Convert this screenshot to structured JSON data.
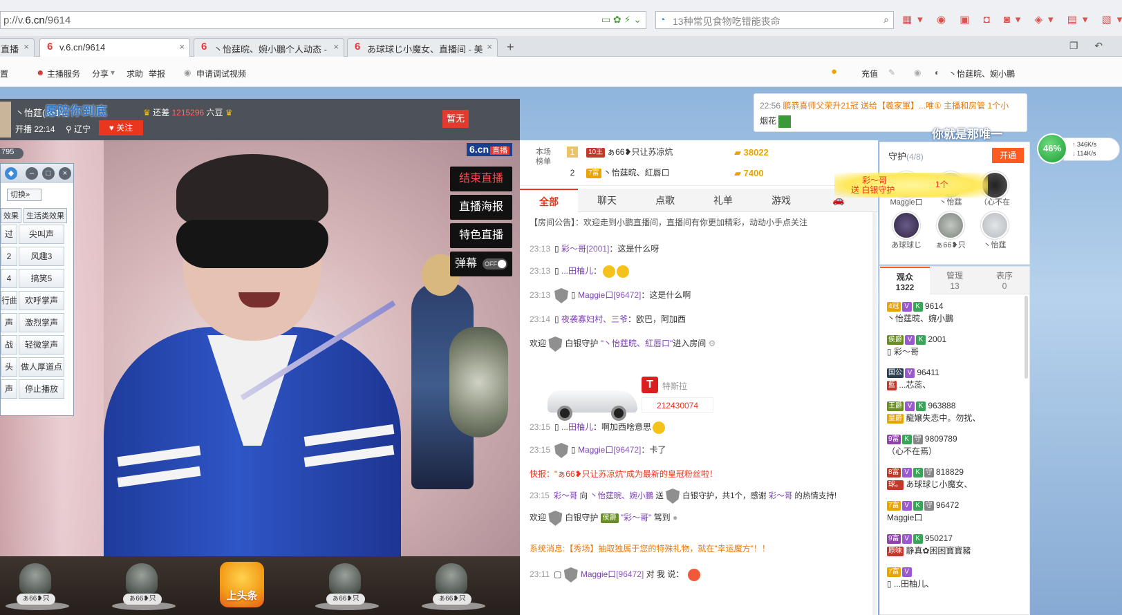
{
  "browser": {
    "url_prefix": "p://v.",
    "url_host": "6.cn",
    "url_path": "/9614",
    "search_placeholder": "13种常见食物吃错能丧命",
    "tabs": [
      {
        "label": "直播",
        "active": false
      },
      {
        "label": "v.6.cn/9614",
        "active": true
      },
      {
        "label": "丶怡莛晥、婉小鵬个人动态 -",
        "active": false
      },
      {
        "label": "あ球球じ小魔女、直播间 - 美",
        "active": false
      }
    ]
  },
  "site_nav": {
    "left": [
      "置",
      "主播服务",
      "分享",
      "求助",
      "举报",
      "申请调试视频"
    ],
    "recharge": "充值",
    "username": "丶怡莛晥、婉小鵬"
  },
  "anchor": {
    "name": "丶怡莛",
    "name_suffix": "614）",
    "overlay_text": "愿陪你到底",
    "rank_prefix": "还差",
    "rank_num": "1215296",
    "rank_suffix": "六豆",
    "start_time": "开播 22:14",
    "location": "辽宁",
    "follow_label": "关注",
    "flag_label": "暂无"
  },
  "video": {
    "logo": "6.cn",
    "logo_live": "直播",
    "buttons": [
      "结束直播",
      "直播海报",
      "特色直播"
    ],
    "danmu_label": "弹幕",
    "danmu_state": "OFF"
  },
  "effects_panel": {
    "count": "795",
    "switch_label": "切换»",
    "tabs": [
      "效果",
      "生活类效果"
    ],
    "cells_left": [
      "过",
      "2",
      "4",
      "行曲",
      "声",
      "战",
      "头",
      "声"
    ],
    "cells_right": [
      "尖叫声",
      "风趣3",
      "搞笑5",
      "欢呼掌声",
      "激烈掌声",
      "轻微掌声",
      "做人厚道点",
      "停止播放"
    ]
  },
  "gift_strip": {
    "items": [
      "ぁ66❥只",
      "ぁ66❥只",
      "ぁ66❥只",
      "ぁ66❥只"
    ],
    "hot_label": "上头条"
  },
  "rank_board": {
    "label": "本场榜单",
    "rows": [
      {
        "no": "1",
        "badge": "10王",
        "name": "ぁ66❥只让苏凉炕",
        "coins": "38022"
      },
      {
        "no": "2",
        "badge": "7富",
        "name": "丶怡莛晥、紅唇口",
        "coins": "7400"
      }
    ]
  },
  "chat": {
    "tabs": [
      "全部",
      "聊天",
      "点歌",
      "礼单",
      "游戏"
    ],
    "notice": "【房间公告】：欢迎走到小鹏直播间，直播间有你更加精彩，动动小手点关注",
    "messages": [
      {
        "time": "23:13",
        "user": "彩～哥",
        "num": "[2001]",
        "text": "：这是什么呀"
      },
      {
        "time": "23:13",
        "user": "...田柚儿",
        "num": "",
        "text": "："
      },
      {
        "time": "23:13",
        "user": "Maggie口",
        "num": "[96472]",
        "text": "：这是什么啊"
      },
      {
        "time": "23:14",
        "user": "夜袭寡妇村、三爷",
        "num": "",
        "text": "：欧巴，阿加西"
      },
      {
        "time": "23:15",
        "user": "...田柚儿",
        "num": "",
        "text": "：啊加西啥意思"
      },
      {
        "time": "23:15",
        "user": "Maggie口",
        "num": "[96472]",
        "text": "：卡了"
      },
      {
        "time": "23:11",
        "user": "Maggie口",
        "num": "[96472]",
        "text": "对 我 说："
      }
    ],
    "welcome_1_prefix": "欢迎",
    "welcome_1_role": "白银守护",
    "welcome_1_user": "\"丶怡莛晥、紅唇口\"",
    "welcome_1_suffix": "进入房间",
    "car_name": "特斯拉",
    "car_number": "212430074",
    "flash": "快报：\"ぁ66❥只让苏凉炕\"成为最新的皇冠粉丝啦！",
    "gift_time": "23:15",
    "gift_user": "彩～哥",
    "gift_to": "向",
    "gift_target": "丶怡莛晥、婉小鵬",
    "gift_text": "送",
    "gift_item": "白银守护，共1个，感谢",
    "gift_thanks_user": "彩～哥",
    "gift_end": "的热情支持!",
    "welcome_2_prefix": "欢迎",
    "welcome_2_role": "白银守护",
    "welcome_2_user": "\"彩～哥\"",
    "welcome_2_suffix": "驾到",
    "system": "系统消息:【秀场】抽取独属于您的特殊礼物，就在\"幸运魔方\"！！"
  },
  "top_notice": {
    "time": "22:56",
    "text": "鹏恭喜师父荣升21冠 送给【羲家軍】...唯① 主播和房管 1个小",
    "text2": "烟花"
  },
  "banner_text": "你就是那唯一",
  "speed": {
    "percent": "46%",
    "up": "346K/s",
    "down": "114K/s"
  },
  "guard": {
    "title": "守护",
    "count": "(4/8)",
    "open_label": "开通",
    "popup_user": "彩～哥",
    "popup_text": "送 白银守护",
    "popup_count": "1个",
    "names_row1": [
      "Maggie口",
      "丶怡莛",
      "（心不在"
    ],
    "names_row2": [
      "あ球球じ",
      "ぁ66❥只",
      "丶怡莛"
    ]
  },
  "audience": {
    "tabs": [
      {
        "label": "观众",
        "count": "1322"
      },
      {
        "label": "管理",
        "count": "13"
      },
      {
        "label": "表序",
        "count": "0"
      }
    ],
    "users": [
      {
        "lvl": "4冠",
        "id": "9614",
        "name": "丶怡莛晥、婉小鵬"
      },
      {
        "lvl": "侯爵",
        "id": "2001",
        "name": "彩～哥"
      },
      {
        "lvl": "国公",
        "id": "96411",
        "name": "...芯蕊、"
      },
      {
        "lvl": "王爵",
        "id": "963888",
        "name": "龍嬢失恋中。勿扰、"
      },
      {
        "lvl": "9富",
        "id": "9809789",
        "name": "（心不在焉）"
      },
      {
        "lvl": "8富",
        "id": "818829",
        "name": "あ球球じ小魔女、"
      },
      {
        "lvl": "7富",
        "id": "96472",
        "name": "Maggie口"
      },
      {
        "lvl": "9富",
        "id": "950217",
        "name": "静真✿困困寶寶豬"
      },
      {
        "lvl": "7富",
        "id": "",
        "name": "...田柚儿、"
      }
    ]
  }
}
